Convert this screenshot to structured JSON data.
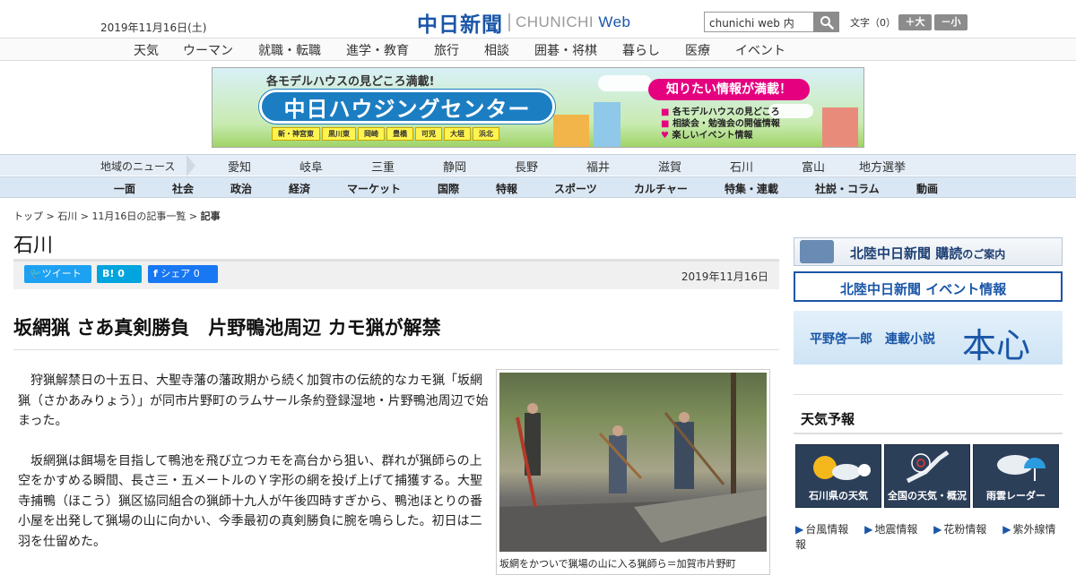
{
  "header": {
    "date": "2019年11月16日(土)",
    "logo_jp": "中日新聞",
    "logo_en": "CHUNICHI",
    "logo_web": "Web",
    "search_placeholder": "chunichi web 内",
    "font_label": "文字（0）",
    "font_larger": "＋大",
    "font_smaller": "－小"
  },
  "top_nav": [
    "天気",
    "ウーマン",
    "就職・転職",
    "進学・教育",
    "旅行",
    "相談",
    "囲碁・将棋",
    "暮らし",
    "医療",
    "イベント"
  ],
  "banner": {
    "catch": "各モデルハウスの見どころ満載!",
    "title": "中日ハウジングセンター",
    "places": [
      "新・神宮東",
      "黒川東",
      "岡崎",
      "豊橋",
      "可児",
      "大垣",
      "浜北"
    ],
    "callout": "知りたい情報が満載！",
    "bullets": [
      "各モデルハウスの見どころ",
      "相談会・勉強会の開催情報",
      "楽しいイベント情報"
    ]
  },
  "region_nav": {
    "label": "地域のニュース",
    "items": [
      "愛知",
      "岐阜",
      "三重",
      "静岡",
      "長野",
      "福井",
      "滋賀",
      "石川",
      "富山",
      "地方選挙"
    ]
  },
  "section_nav": [
    "一面",
    "社会",
    "政治",
    "経済",
    "マーケット",
    "国際",
    "特報",
    "スポーツ",
    "カルチャー",
    "特集・連載",
    "社説・コラム",
    "動画"
  ],
  "breadcrumb": {
    "items": [
      "トップ",
      "石川",
      "11月16日の記事一覧"
    ],
    "current": "記事",
    "sep": " > "
  },
  "area_title": "石川",
  "share": {
    "tweet": "ツイート",
    "hatena_count": "0",
    "fb_share": "シェア",
    "fb_count": "0",
    "date": "2019年11月16日"
  },
  "article": {
    "headline": "坂網猟 さあ真剣勝負　片野鴨池周辺 カモ猟が解禁",
    "paragraphs": [
      "狩猟解禁日の十五日、大聖寺藩の藩政期から続く加賀市の伝統的なカモ猟「坂網猟（さかあみりょう）」が同市片野町のラムサール条約登録湿地・片野鴨池周辺で始まった。",
      "坂網猟は餌場を目指して鴨池を飛び立つカモを高台から狙い、群れが猟師らの上空をかすめる瞬間、長さ三・五メートルのＹ字形の網を投げ上げて捕獲する。大聖寺捕鴨（ほこう）猟区協同組合の猟師十九人が午後四時すぎから、鴨池ほとりの番小屋を出発して猟場の山に向かい、今季最初の真剣勝負に腕を鳴らした。初日は二羽を仕留めた。"
    ],
    "photo_caption": "坂網をかついで猟場の山に入る猟師ら＝加賀市片野町"
  },
  "sidebar": {
    "subscribe": "北陸中日新聞 購読",
    "subscribe_suffix": "のご案内",
    "event": "北陸中日新聞 イベント情報",
    "novel_author": "平野啓一郎　連載小説",
    "novel_title": "本心",
    "weather_title": "天気予報",
    "weather_tiles": [
      "石川県の天気",
      "全国の天気・概況",
      "雨雲レーダー"
    ],
    "weather_links": [
      "台風情報",
      "地震情報",
      "花粉情報",
      "紫外線情報"
    ]
  },
  "colors": {
    "brand_blue": "#1a56a8",
    "twitter": "#1da1f2",
    "hatena": "#00a4de",
    "facebook": "#1877f2",
    "nav_bg": "#d9e6f3"
  }
}
